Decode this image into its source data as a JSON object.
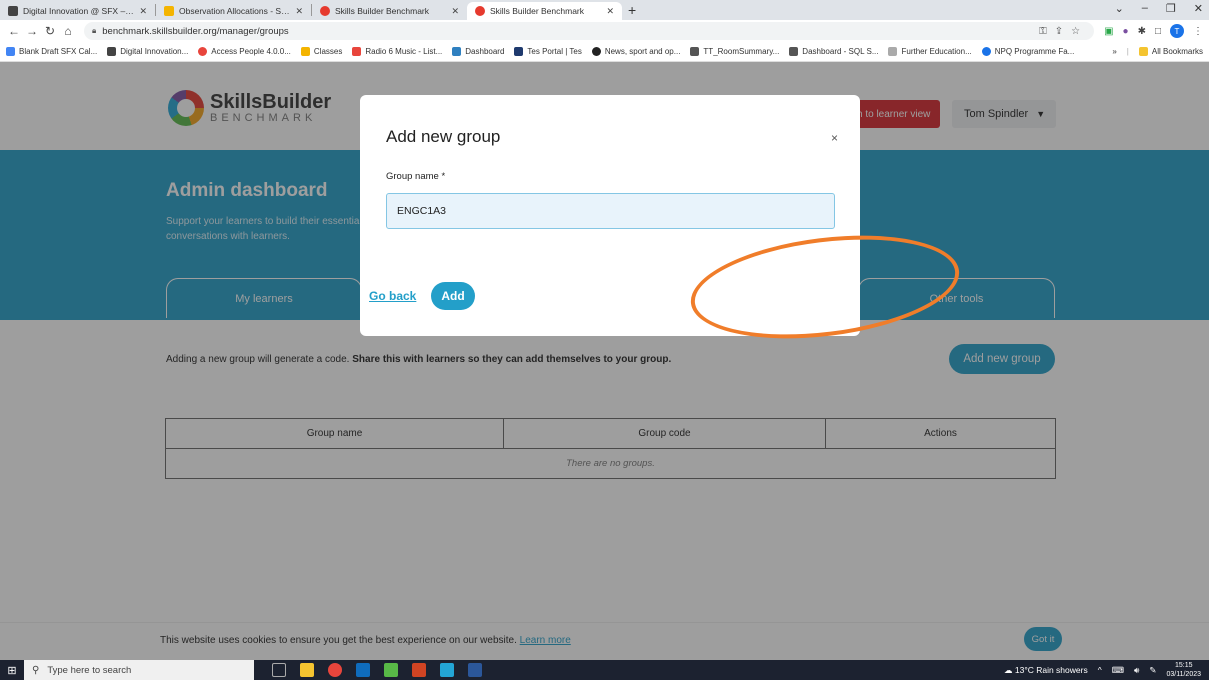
{
  "browser": {
    "tabs": [
      {
        "label": "Digital Innovation @ SFX – Digit",
        "fav": "#444",
        "active": false
      },
      {
        "label": "Observation Allocations - Social",
        "fav": "#f4b400",
        "active": false
      },
      {
        "label": "Skills Builder Benchmark",
        "fav": "#e63a2e",
        "active": false
      },
      {
        "label": "Skills Builder Benchmark",
        "fav": "#e63a2e",
        "active": true
      }
    ],
    "new_tab": "+",
    "url": "benchmark.skillsbuilder.org/manager/groups",
    "avatar_letter": "T",
    "bookmarks": [
      {
        "label": "Blank Draft SFX Cal...",
        "color": "#4285f4"
      },
      {
        "label": "Digital Innovation...",
        "color": "#444"
      },
      {
        "label": "Access People 4.0.0...",
        "color": "#e8453c"
      },
      {
        "label": "Classes",
        "color": "#f4b400"
      },
      {
        "label": "Radio 6 Music - List...",
        "color": "#e8453c"
      },
      {
        "label": "Dashboard",
        "color": "#2f80c0"
      },
      {
        "label": "Tes Portal | Tes",
        "color": "#1f3a6e"
      },
      {
        "label": "News, sport and op...",
        "color": "#222"
      },
      {
        "label": "TT_RoomSummary...",
        "color": "#555"
      },
      {
        "label": "Dashboard - SQL S...",
        "color": "#555"
      },
      {
        "label": "Further Education...",
        "color": "#aaa"
      },
      {
        "label": "NPQ Programme Fa...",
        "color": "#1a73e8"
      }
    ],
    "bookmarks_overflow": "»",
    "all_bookmarks": "All Bookmarks"
  },
  "header": {
    "logo_bold": "Skills",
    "logo_rest": "Builder",
    "logo_sub": "BENCHMARK",
    "learner_view_button": "ch to learner view",
    "user_name": "Tom Spindler"
  },
  "hero": {
    "title": "Admin dashboard",
    "text_line1": "Support your learners to build their essentia",
    "text_line2": "conversations with learners.",
    "tabs": {
      "my_learners": "My learners",
      "other_tools": "Other tools"
    }
  },
  "content": {
    "info_text": "Adding a new group will generate a code.",
    "info_bold": "Share this with learners so they can add themselves to your group.",
    "add_group_button": "Add new group",
    "table": {
      "headers": [
        "Group name",
        "Group code",
        "Actions"
      ],
      "empty_message": "There are no groups."
    }
  },
  "cookie": {
    "text": "This website uses cookies to ensure you get the best experience on our website.",
    "link": "Learn more",
    "button": "Got it"
  },
  "modal": {
    "title": "Add new group",
    "close": "×",
    "field_label": "Group name *",
    "field_value": "ENGC1A3",
    "go_back": "Go back",
    "add": "Add"
  },
  "taskbar": {
    "search_placeholder": "Type here to search",
    "weather": "13°C  Rain showers",
    "time": "15:15",
    "date": "03/11/2023"
  },
  "colors": {
    "brand_blue": "#239fc9",
    "red_button": "#d8262c",
    "annotation": "#f07d2a"
  }
}
